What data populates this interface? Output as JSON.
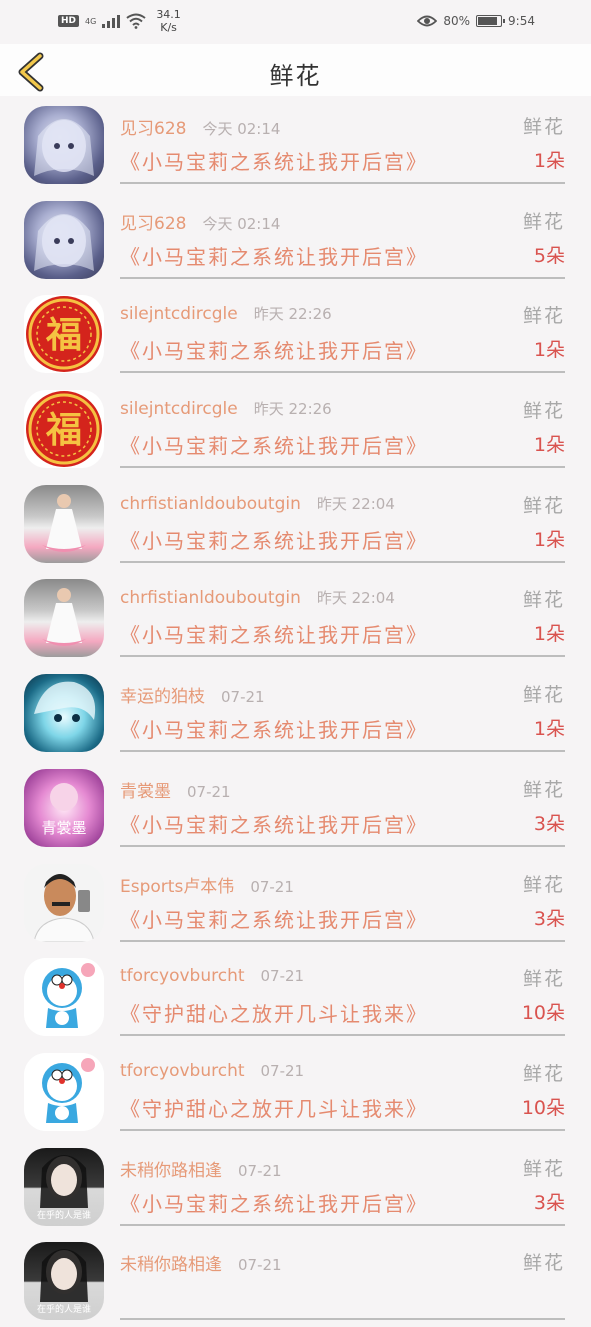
{
  "status": {
    "hd": "HD",
    "signal": "4G",
    "speed_value": "34.1",
    "speed_unit": "K/s",
    "battery": "80%",
    "time": "9:54"
  },
  "header": {
    "title": "鲜花"
  },
  "rows": [
    {
      "name": "见习628",
      "time": "今天 02:14",
      "type": "鲜花",
      "book": "《小马宝莉之系统让我开后宫》",
      "count": "1朵",
      "avatar": "anime"
    },
    {
      "name": "见习628",
      "time": "今天 02:14",
      "type": "鲜花",
      "book": "《小马宝莉之系统让我开后宫》",
      "count": "5朵",
      "avatar": "anime"
    },
    {
      "name": "silejntcdircgle",
      "time": "昨天 22:26",
      "type": "鲜花",
      "book": "《小马宝莉之系统让我开后宫》",
      "count": "1朵",
      "avatar": "fu"
    },
    {
      "name": "silejntcdircgle",
      "time": "昨天 22:26",
      "type": "鲜花",
      "book": "《小马宝莉之系统让我开后宫》",
      "count": "1朵",
      "avatar": "fu"
    },
    {
      "name": "chrfistianldouboutgin",
      "time": "昨天 22:04",
      "type": "鲜花",
      "book": "《小马宝莉之系统让我开后宫》",
      "count": "1朵",
      "avatar": "girl"
    },
    {
      "name": "chrfistianldouboutgin",
      "time": "昨天 22:04",
      "type": "鲜花",
      "book": "《小马宝莉之系统让我开后宫》",
      "count": "1朵",
      "avatar": "girl"
    },
    {
      "name": "幸运的狛枝",
      "time": "07-21",
      "type": "鲜花",
      "book": "《小马宝莉之系统让我开后宫》",
      "count": "1朵",
      "avatar": "teal"
    },
    {
      "name": "青裳墨",
      "time": "07-21",
      "type": "鲜花",
      "book": "《小马宝莉之系统让我开后宫》",
      "count": "3朵",
      "avatar": "pink"
    },
    {
      "name": "Esports卢本伟",
      "time": "07-21",
      "type": "鲜花",
      "book": "《小马宝莉之系统让我开后宫》",
      "count": "3朵",
      "avatar": "man"
    },
    {
      "name": "tforcyovburcht",
      "time": "07-21",
      "type": "鲜花",
      "book": "《守护甜心之放开几斗让我来》",
      "count": "10朵",
      "avatar": "dora"
    },
    {
      "name": "tforcyovburcht",
      "time": "07-21",
      "type": "鲜花",
      "book": "《守护甜心之放开几斗让我来》",
      "count": "10朵",
      "avatar": "dora"
    },
    {
      "name": "未稍你路相逢",
      "time": "07-21",
      "type": "鲜花",
      "book": "《小马宝莉之系统让我开后宫》",
      "count": "3朵",
      "avatar": "dark"
    },
    {
      "name": "未稍你路相逢",
      "time": "07-21",
      "type": "鲜花",
      "book": "",
      "count": "",
      "avatar": "dark"
    }
  ],
  "avatar_overlays": {
    "fu_char": "福",
    "pink_text": "青裳墨",
    "dark_text": "在乎的人是谁"
  }
}
